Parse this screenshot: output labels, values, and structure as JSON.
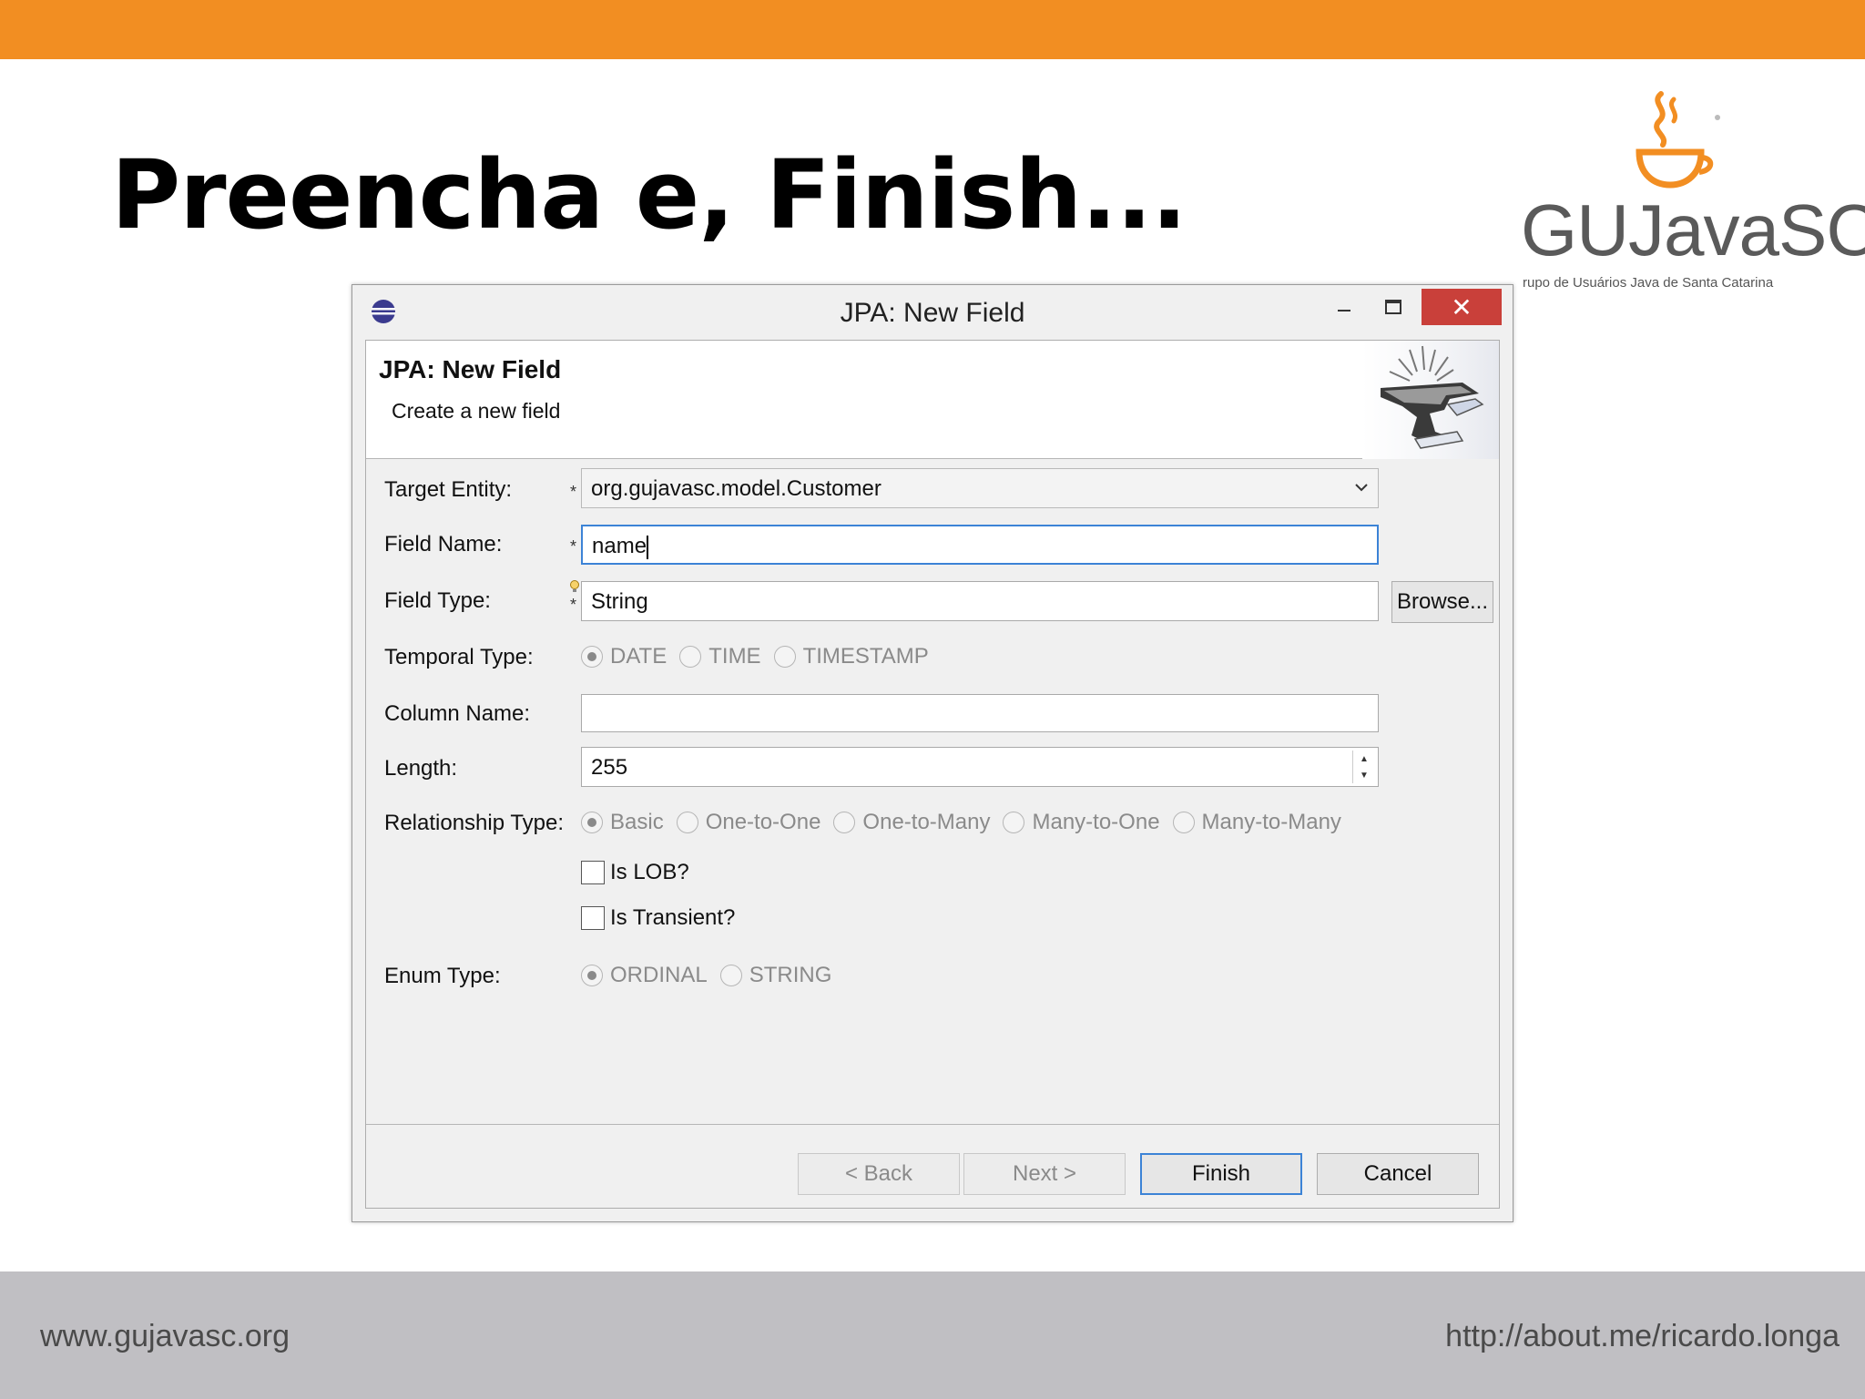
{
  "slide": {
    "title": "Preencha e, Finish...",
    "logo_text": "GUJavaSC",
    "logo_subtitle": "rupo de Usuários Java de Santa Catarina",
    "footer_left": "www.gujavasc.org",
    "footer_right": "http://about.me/ricardo.longa",
    "accent_color": "#f28e22"
  },
  "window": {
    "title": "JPA: New Field",
    "minimize": "–",
    "maximize": "□",
    "close": "✕"
  },
  "banner": {
    "title": "JPA: New Field",
    "subtitle": "Create a new field",
    "graphic": "anvil-icon"
  },
  "form": {
    "target_entity": {
      "label": "Target Entity:",
      "value": "org.gujavasc.model.Customer",
      "required_mark": "*"
    },
    "field_name": {
      "label": "Field Name:",
      "value": "name",
      "required_mark": "*"
    },
    "field_type": {
      "label": "Field Type:",
      "value": "String",
      "required_mark": "*",
      "browse_label": "Browse..."
    },
    "temporal_type": {
      "label": "Temporal Type:",
      "options": [
        "DATE",
        "TIME",
        "TIMESTAMP"
      ],
      "selected": "DATE"
    },
    "column_name": {
      "label": "Column Name:",
      "value": ""
    },
    "length": {
      "label": "Length:",
      "value": "255"
    },
    "relationship_type": {
      "label": "Relationship Type:",
      "options": [
        "Basic",
        "One-to-One",
        "One-to-Many",
        "Many-to-One",
        "Many-to-Many"
      ],
      "selected": "Basic"
    },
    "is_lob": {
      "label": "Is LOB?",
      "checked": false
    },
    "is_transient": {
      "label": "Is Transient?",
      "checked": false
    },
    "enum_type": {
      "label": "Enum Type:",
      "options": [
        "ORDINAL",
        "STRING"
      ],
      "selected": "ORDINAL"
    }
  },
  "buttons": {
    "back": "< Back",
    "next": "Next >",
    "finish": "Finish",
    "cancel": "Cancel"
  }
}
